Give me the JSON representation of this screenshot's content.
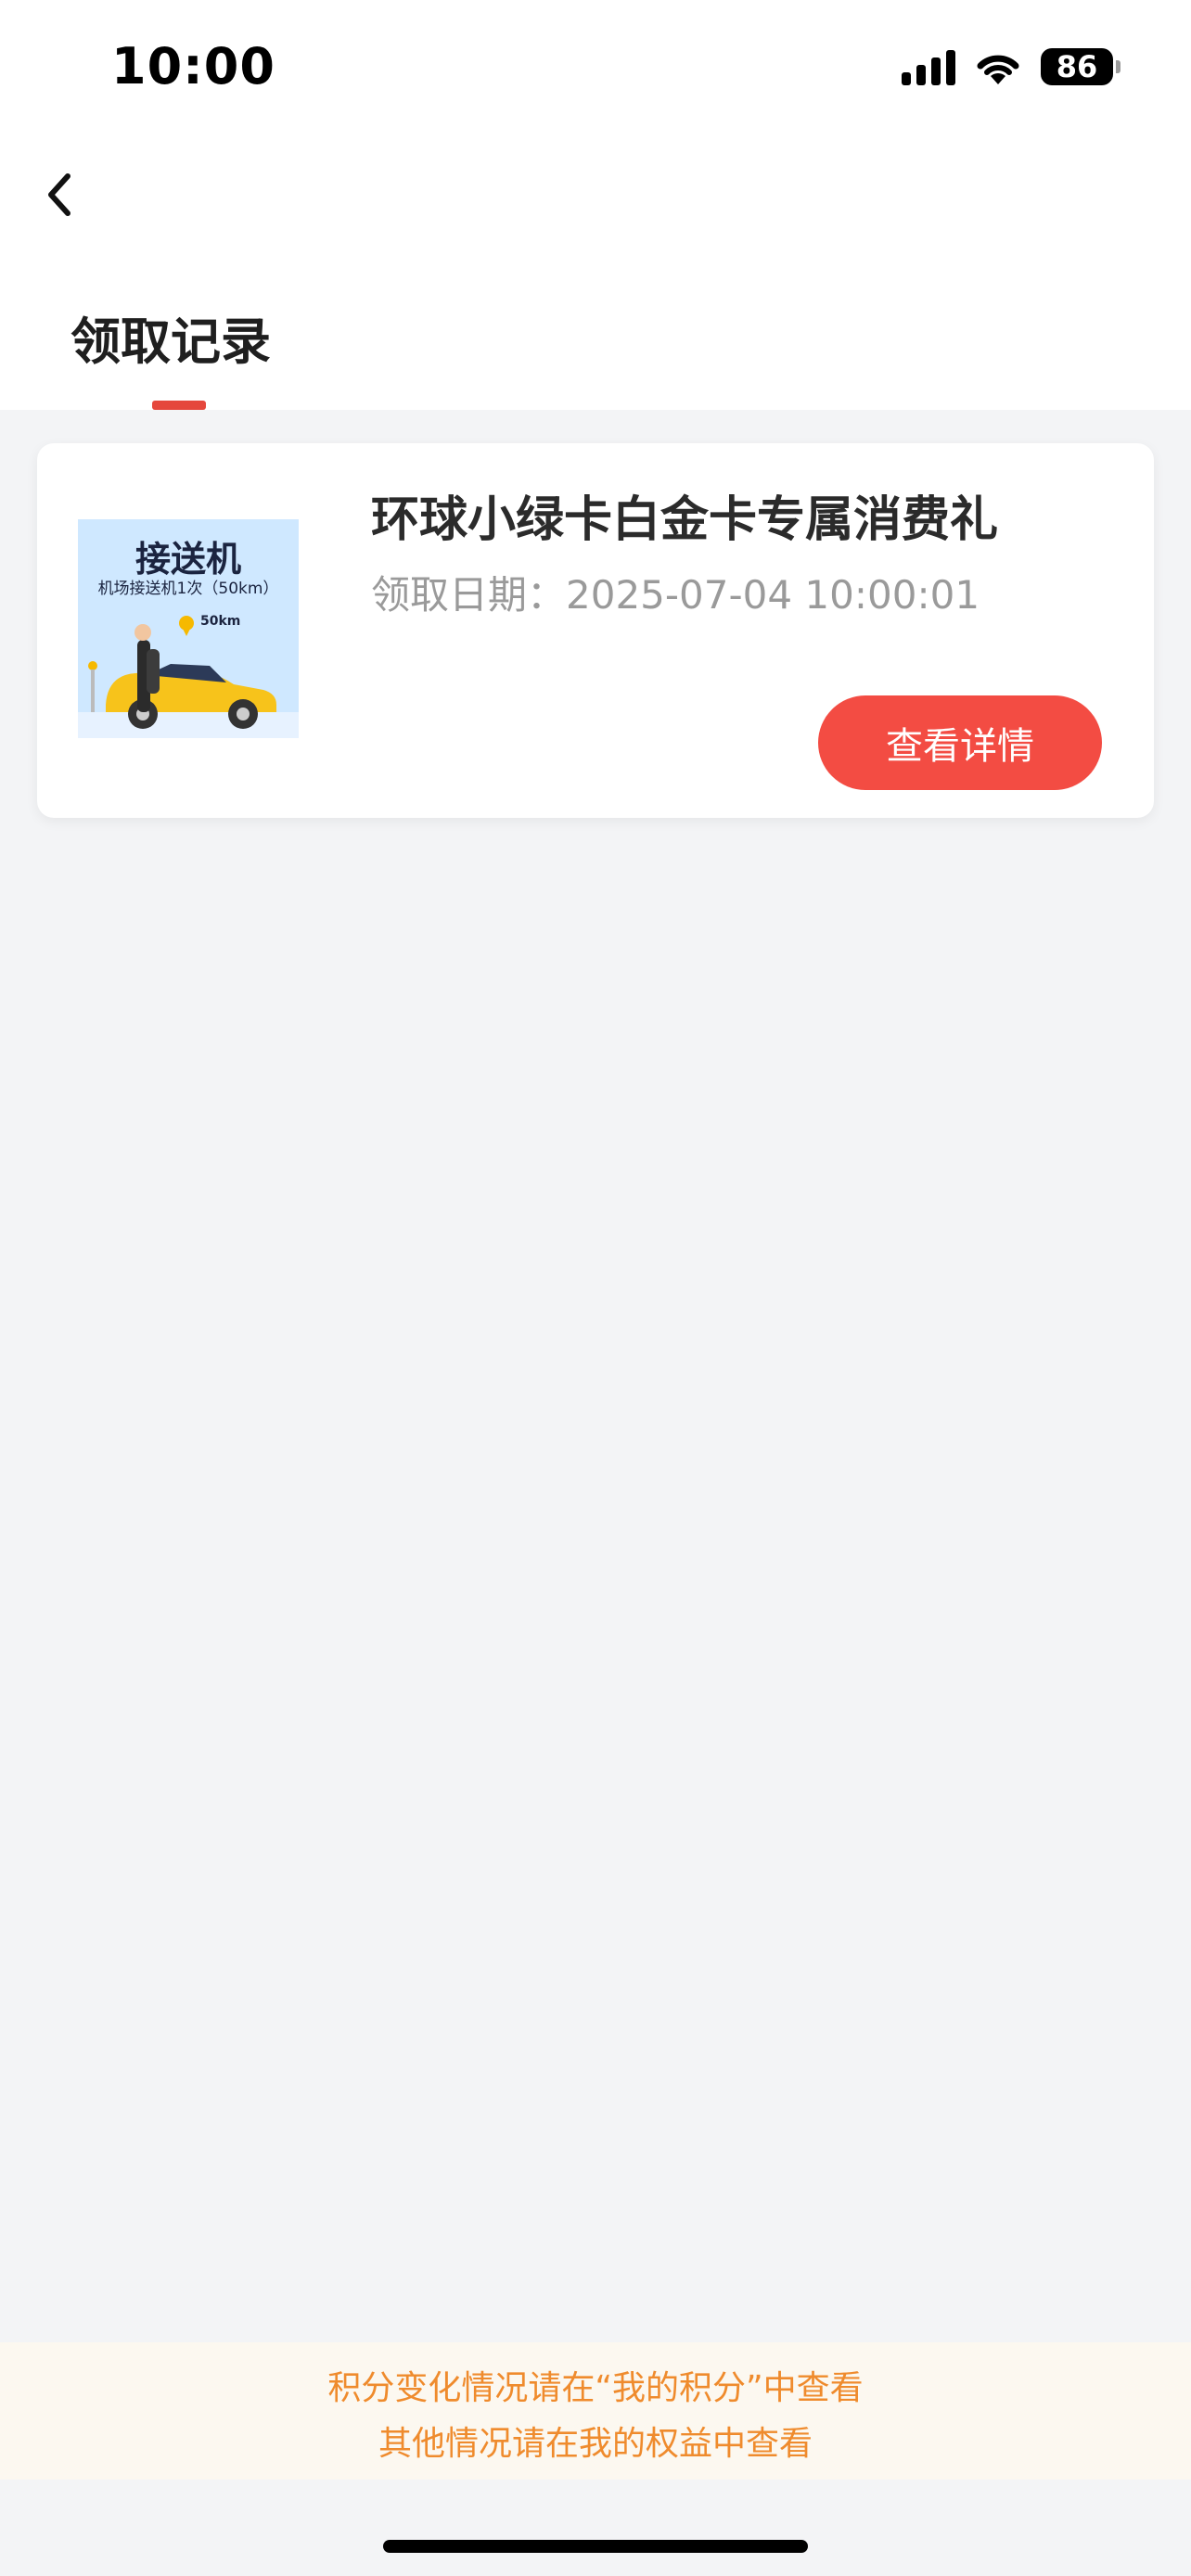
{
  "status_bar": {
    "time": "10:00",
    "battery": "86"
  },
  "nav": {
    "back_icon": "chevron-left-icon"
  },
  "tabs": [
    {
      "label": "领取记录",
      "active": true
    }
  ],
  "records": [
    {
      "thumbnail": {
        "title": "接送机",
        "subtitle": "机场接送机1次（50km）",
        "distance": "50km"
      },
      "title": "环球小绿卡白金卡专属消费礼",
      "date": "领取日期：2025-07-04 10:00:01",
      "button_label": "查看详情"
    }
  ],
  "notice": {
    "line1": "积分变化情况请在“我的积分”中查看",
    "line2": "其他情况请在我的权益中查看"
  },
  "colors": {
    "accent": "#f34c43",
    "notice_text": "#ef8b2d",
    "notice_bg": "#fcf8f0"
  }
}
